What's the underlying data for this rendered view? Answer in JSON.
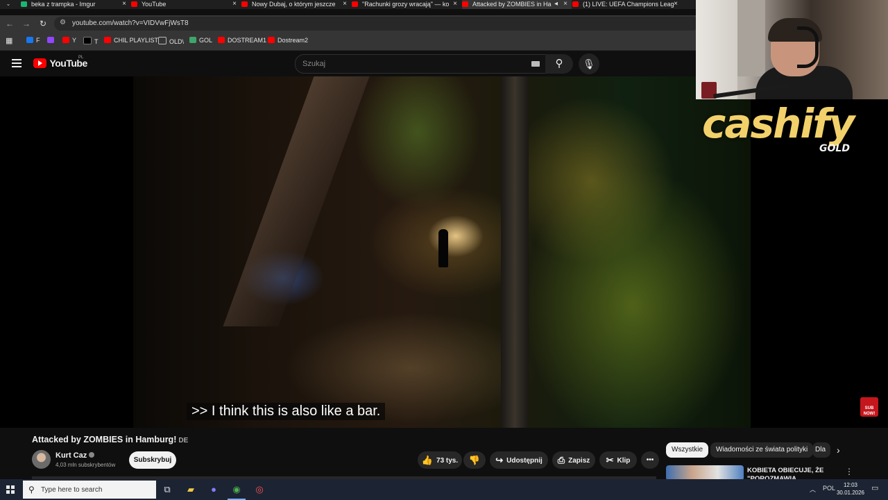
{
  "tabs": [
    {
      "title": "beka z trampka - Imgur",
      "color": "#1bb76e"
    },
    {
      "title": "YouTube",
      "color": "#ff0000"
    },
    {
      "title": "Nowy Dubaj, o którym jeszcze",
      "color": "#ff0000"
    },
    {
      "title": "\"Rachunki grozy wracają\" — ko",
      "color": "#ff0000"
    },
    {
      "title": "Attacked by ZOMBIES in Ha",
      "color": "#ff0000",
      "active": true
    },
    {
      "title": "(1) LIVE: UEFA Champions Leag",
      "color": "#ff0000"
    }
  ],
  "address_bar": {
    "url": "youtube.com/watch?v=VIDVwFjWsT8"
  },
  "bookmarks": [
    {
      "label": "F",
      "icon": "facebook-icon",
      "color": "#1877f2"
    },
    {
      "label": "",
      "icon": "twitch-icon",
      "color": "#9146ff"
    },
    {
      "label": "Y",
      "icon": "youtube-icon",
      "color": "#ff0000"
    },
    {
      "label": "T",
      "icon": "x-icon",
      "color": "#000000"
    },
    {
      "label": "CHIL PLAYLIST",
      "icon": "youtube-icon",
      "color": "#ff0000"
    },
    {
      "label": "OLD\\",
      "icon": "folder-icon",
      "color": "#bbbbbb"
    },
    {
      "label": "GOL",
      "icon": "gol-icon",
      "color": "#3fa56b"
    },
    {
      "label": "DOSTREAM1",
      "icon": "youtube-icon",
      "color": "#ff0000"
    },
    {
      "label": "Dostream2",
      "icon": "youtube-icon",
      "color": "#ff0000"
    }
  ],
  "youtube": {
    "logo": "YouTube",
    "region": "PL",
    "search_placeholder": "Szukaj"
  },
  "video": {
    "caption": ">> I think this is also like a bar.",
    "title": "Attacked by ZOMBIES in Hamburg!",
    "title_flag": "DE",
    "subscribe_badge": "SUB NOW!"
  },
  "overlay": {
    "brand": "cashify",
    "brand_sub": "GOLD"
  },
  "channel": {
    "name": "Kurt Caz",
    "subscribers": "4,03 mln subskrybentów",
    "subscribe_label": "Subskrybuj"
  },
  "actions": {
    "likes": "73 tys.",
    "share": "Udostępnij",
    "save": "Zapisz",
    "clip": "Klip"
  },
  "chips": [
    "Wszystkie",
    "Wiadomości ze świata polityki",
    "Dla"
  ],
  "recommendation": {
    "title": "KOBIETA OBIECUJE, ŻE \"POROZMAWIA"
  },
  "taskbar": {
    "search_placeholder": "Type here to search",
    "lang": "POL",
    "time": "12:03",
    "date": "30.01.2026"
  }
}
